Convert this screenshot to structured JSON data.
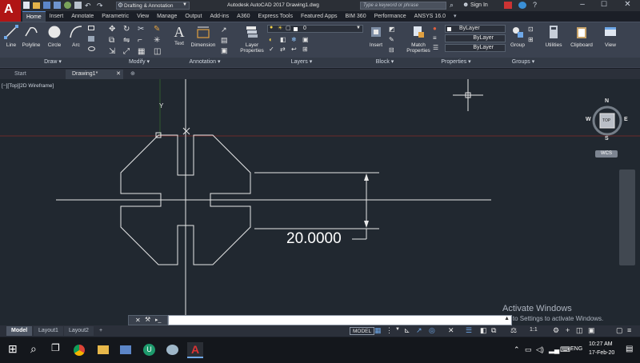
{
  "titlebar": {
    "app_letter": "A",
    "workspace": "Drafting & Annotation",
    "title": "Autodesk AutoCAD 2017   Drawing1.dwg",
    "search_placeholder": "Type a keyword or phrase",
    "sign_in": "Sign In"
  },
  "ribbon_tabs": [
    "Home",
    "Insert",
    "Annotate",
    "Parametric",
    "View",
    "Manage",
    "Output",
    "Add-ins",
    "A360",
    "Express Tools",
    "Featured Apps",
    "BIM 360",
    "Performance",
    "ANSYS 16.0"
  ],
  "draw_tools": {
    "line": "Line",
    "polyline": "Polyline",
    "circle": "Circle",
    "arc": "Arc"
  },
  "annotation_tools": {
    "text": "Text",
    "dimension": "Dimension"
  },
  "layers": {
    "layer_properties": "Layer Properties",
    "current_layer": "0"
  },
  "block": {
    "insert": "Insert"
  },
  "properties": {
    "match": "Match Properties",
    "color": "ByLayer",
    "linetype": "ByLayer",
    "lineweight": "ByLayer"
  },
  "groups": {
    "group": "Group"
  },
  "right_tools": {
    "utilities": "Utilities",
    "clipboard": "Clipboard",
    "view": "View"
  },
  "panel_labels": {
    "draw": "Draw",
    "modify": "Modify",
    "annotation": "Annotation",
    "layers": "Layers",
    "block": "Block",
    "properties": "Properties",
    "groups": "Groups"
  },
  "file_tabs": {
    "start": "Start",
    "drawing": "Drawing1*"
  },
  "viewport": {
    "label": "[−][Top][2D Wireframe]",
    "dimension_text": "20.0000",
    "ucs_y": "Y",
    "compass": {
      "n": "N",
      "s": "S",
      "e": "E",
      "w": "W",
      "top": "TOP",
      "wcs": "WCS"
    },
    "activate_title": "Activate Windows",
    "activate_sub": "Go to Settings to activate Windows."
  },
  "layout_tabs": {
    "model": "Model",
    "layout1": "Layout1",
    "layout2": "Layout2"
  },
  "status": {
    "model": "MODEL",
    "scale": "1:1"
  },
  "taskbar": {
    "language": "ENG",
    "time": "10:27 AM",
    "date": "17-Feb-20"
  }
}
